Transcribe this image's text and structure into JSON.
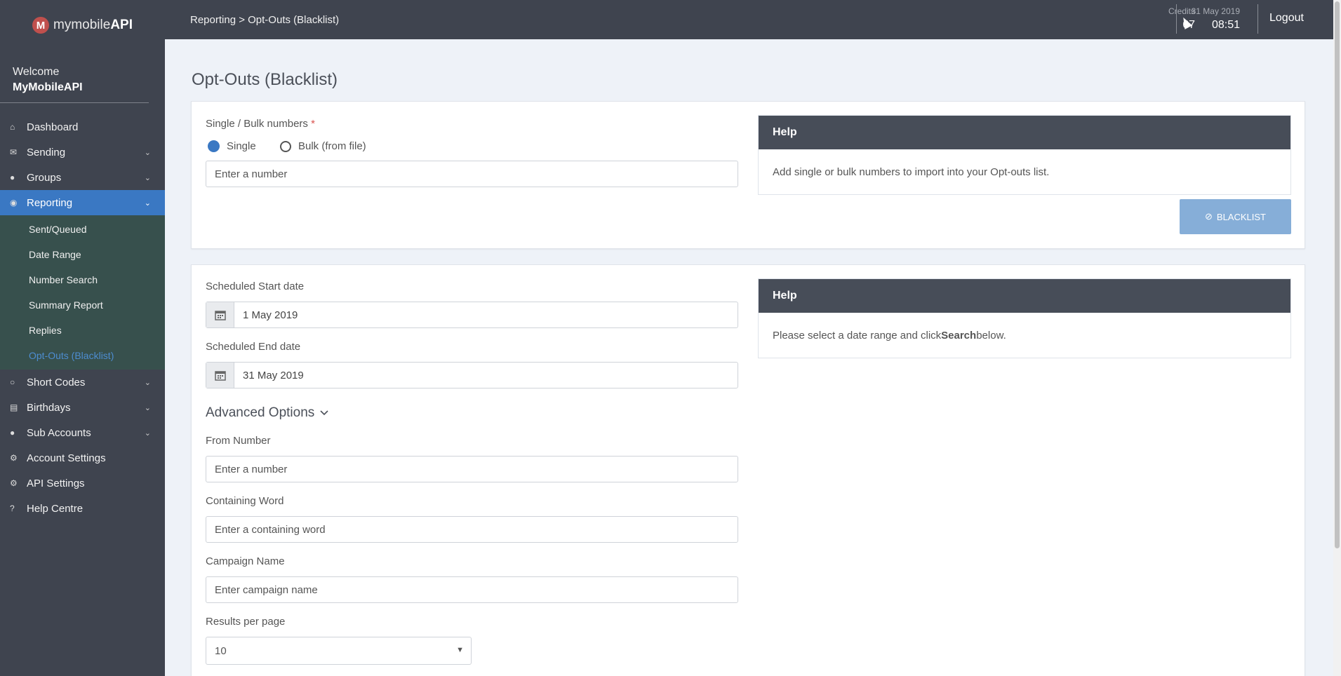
{
  "brand": {
    "mark": "M",
    "name_light": "mymobile",
    "name_bold": "API"
  },
  "welcome": {
    "greeting": "Welcome",
    "user": "MyMobileAPI"
  },
  "nav": {
    "dashboard": "Dashboard",
    "sending": "Sending",
    "groups": "Groups",
    "reporting": "Reporting",
    "reporting_sub": [
      "Sent/Queued",
      "Date Range",
      "Number Search",
      "Summary Report",
      "Replies",
      "Opt-Outs (Blacklist)"
    ],
    "short_codes": "Short Codes",
    "birthdays": "Birthdays",
    "sub_accounts": "Sub Accounts",
    "account_settings": "Account Settings",
    "api_settings": "API Settings",
    "help_centre": "Help Centre"
  },
  "topbar": {
    "breadcrumb": "Reporting > Opt-Outs (Blacklist)",
    "credits_label": "Credits",
    "credits_value": "67",
    "date": "31 May 2019",
    "time": "08:51",
    "logout": "Logout"
  },
  "page": {
    "title": "Opt-Outs (Blacklist)"
  },
  "import_panel": {
    "label": "Single / Bulk numbers",
    "required_mark": "*",
    "radio_single": "Single",
    "radio_bulk": "Bulk (from file)",
    "selected": "Single",
    "number_placeholder": "Enter a number",
    "help_title": "Help",
    "help_text": "Add single or bulk numbers to import into your Opt-outs list.",
    "blacklist_button": "BLACKLIST"
  },
  "search_panel": {
    "start_label": "Scheduled Start date",
    "start_value": "1 May 2019",
    "end_label": "Scheduled End date",
    "end_value": "31 May 2019",
    "help_title": "Help",
    "help_text_pre": "Please select a date range and click ",
    "help_text_bold": "Search",
    "help_text_post": " below.",
    "advanced": "Advanced Options",
    "from_label": "From Number",
    "from_placeholder": "Enter a number",
    "word_label": "Containing Word",
    "word_placeholder": "Enter a containing word",
    "campaign_label": "Campaign Name",
    "campaign_placeholder": "Enter campaign name",
    "results_label": "Results per page",
    "results_value": "10"
  },
  "colors": {
    "sidebar": "#3f444f",
    "active": "#3a78c3",
    "subnav": "#37504d",
    "help_header": "#474d58",
    "button": "#86aed8"
  }
}
